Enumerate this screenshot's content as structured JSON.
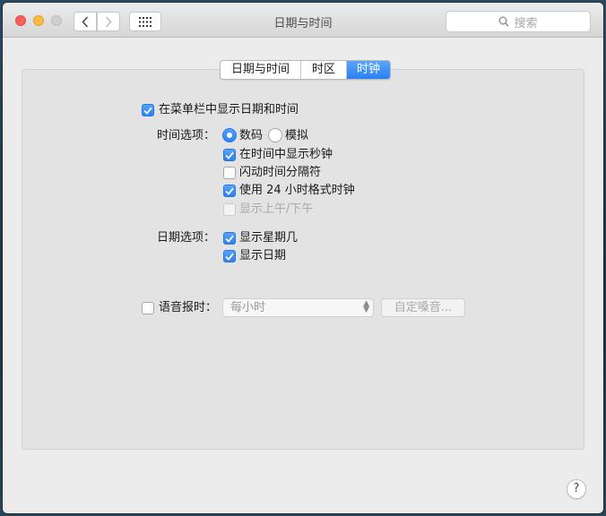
{
  "window": {
    "title": "日期与时间"
  },
  "toolbar": {
    "search_placeholder": "搜索",
    "back_icon": "chevron-left-icon",
    "forward_icon": "chevron-right-icon",
    "grid_icon": "show-all-grid-icon"
  },
  "tabs": [
    {
      "label": "日期与时间",
      "active": false
    },
    {
      "label": "时区",
      "active": false
    },
    {
      "label": "时钟",
      "active": true
    }
  ],
  "clock": {
    "show_in_menubar": {
      "label": "在菜单栏中显示日期和时间",
      "checked": true
    },
    "time_options": {
      "label": "时间选项：",
      "digital": {
        "label": "数码",
        "selected": true
      },
      "analog": {
        "label": "模拟",
        "selected": false
      },
      "show_seconds": {
        "label": "在时间中显示秒钟",
        "checked": true
      },
      "flash_separators": {
        "label": "闪动时间分隔符",
        "checked": false
      },
      "use_24h": {
        "label": "使用 24 小时格式时钟",
        "checked": true
      },
      "show_ampm": {
        "label": "显示上午/下午",
        "checked": false,
        "disabled": true
      }
    },
    "date_options": {
      "label": "日期选项：",
      "show_weekday": {
        "label": "显示星期几",
        "checked": true
      },
      "show_date": {
        "label": "显示日期",
        "checked": true
      }
    },
    "announce_time": {
      "label": "语音报时：",
      "checked": false,
      "interval": "每小时",
      "customize_voice": "自定嗓音..."
    }
  },
  "help": {
    "label": "?"
  },
  "colors": {
    "accent": "#2c80f2",
    "window_bg": "#ececec",
    "panel_bg": "#e3e3e3"
  }
}
